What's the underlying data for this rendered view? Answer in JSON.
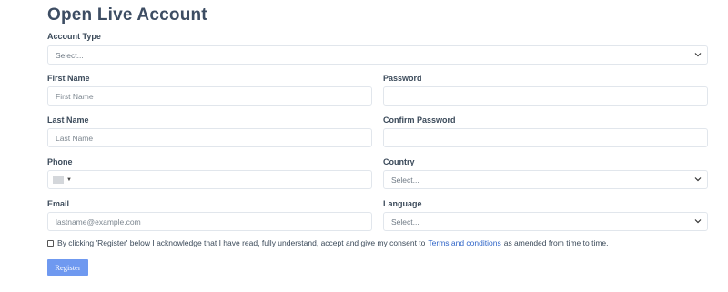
{
  "title": "Open Live Account",
  "account_type": {
    "label": "Account Type",
    "value": "Select..."
  },
  "first_name": {
    "label": "First Name",
    "placeholder": "First Name"
  },
  "password": {
    "label": "Password",
    "placeholder": ""
  },
  "last_name": {
    "label": "Last Name",
    "placeholder": "Last Name"
  },
  "confirm_password": {
    "label": "Confirm Password",
    "placeholder": ""
  },
  "phone": {
    "label": "Phone",
    "flag_icon": "flag-icon",
    "caret_icon": "chevron-down-icon"
  },
  "country": {
    "label": "Country",
    "value": "Select..."
  },
  "email": {
    "label": "Email",
    "placeholder": "lastname@example.com"
  },
  "language": {
    "label": "Language",
    "value": "Select..."
  },
  "consent": {
    "text_before": "By clicking 'Register' below I acknowledge that I have read, fully understand, accept and give my consent to",
    "link_text": "Terms and conditions",
    "text_after": "as amended from time to time.",
    "checked": false
  },
  "register_button": "Register",
  "colors": {
    "title": "#3d4d63",
    "link": "#2f65c8",
    "button_bg": "#6f99f0",
    "border": "#e1e6ec"
  }
}
